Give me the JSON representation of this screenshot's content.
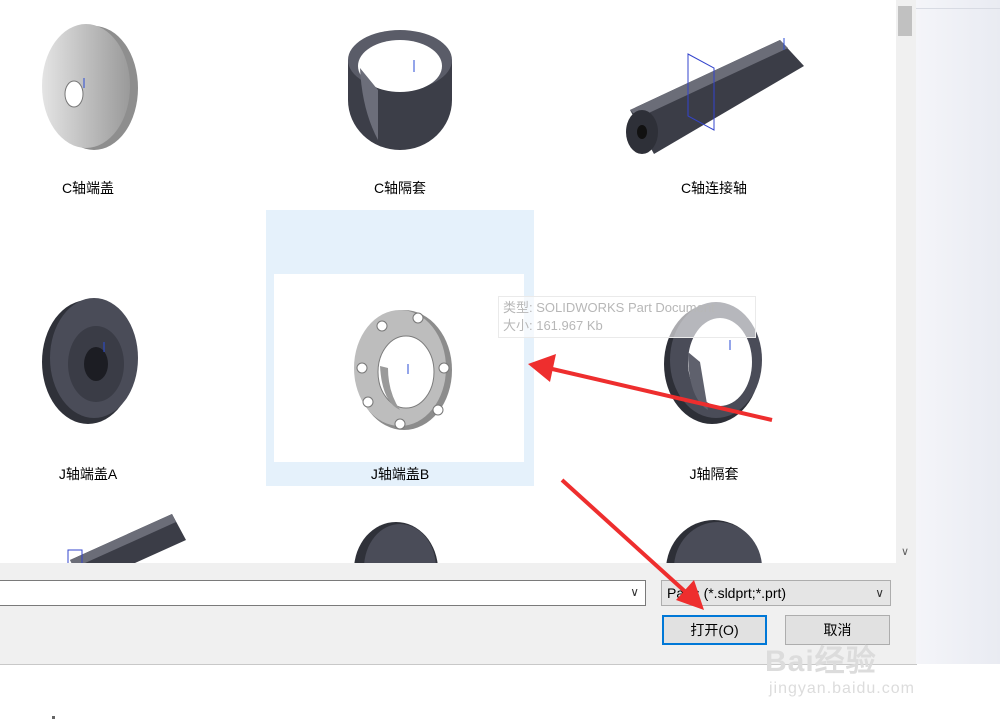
{
  "files": [
    {
      "label": "C轴端盖",
      "selected": false
    },
    {
      "label": "C轴隔套",
      "selected": false
    },
    {
      "label": "C轴连接轴",
      "selected": false
    },
    {
      "label": "J轴端盖A",
      "selected": false
    },
    {
      "label": "J轴端盖B",
      "selected": true
    },
    {
      "label": "J轴隔套",
      "selected": false
    }
  ],
  "tooltip": {
    "type_line": "类型: SOLIDWORKS Part Document",
    "size_line": "大小: 161.967 Kb"
  },
  "filename": {
    "value": ""
  },
  "filetype": {
    "value": "Parts (*.sldprt;*.prt)"
  },
  "buttons": {
    "open": "打开(O)",
    "cancel": "取消"
  },
  "watermark": {
    "brand": "Bai经验",
    "url": "jingyan.baidu.com"
  },
  "icons": {
    "scroll_down": "chevron-down-icon",
    "dropdown": "chevron-down-icon",
    "annotation": "red-arrow-icon"
  },
  "colors": {
    "selection": "#e5f1fb",
    "accent": "#0078d7",
    "arrow": "#ee2e2e"
  }
}
